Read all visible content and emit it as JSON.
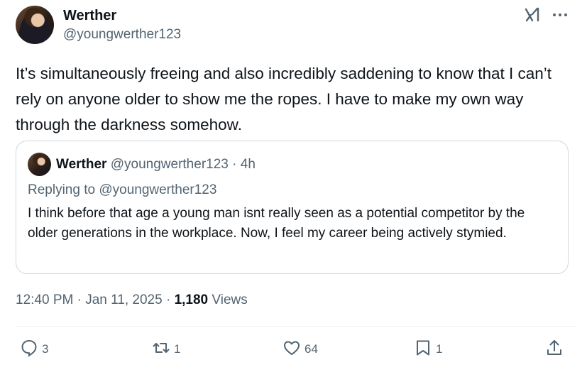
{
  "author": {
    "name": "Werther",
    "handle": "@youngwerther123"
  },
  "tweet": {
    "text": "It’s simultaneously freeing and also incredibly saddening to know that I can’t rely on anyone older to show me the ropes. I have to make my own way through the darkness somehow.",
    "time": "12:40 PM",
    "separator": "·",
    "date": "Jan 11, 2025",
    "views_count": "1,180",
    "views_label": "Views"
  },
  "quote": {
    "name": "Werther",
    "handle": "@youngwerther123",
    "separator": "·",
    "age": "4h",
    "replying_to": "Replying to @youngwerther123",
    "text": "I think before that age a young man isnt really seen as a potential competitor by the older generations in the workplace. Now, I feel my career being actively stymied."
  },
  "actions": {
    "reply_count": "3",
    "repost_count": "1",
    "like_count": "64",
    "bookmark_count": "1"
  },
  "icons": {
    "grok": "grok-icon",
    "more": "more-icon",
    "reply": "reply-icon",
    "repost": "repost-icon",
    "like": "heart-icon",
    "bookmark": "bookmark-icon",
    "share": "share-icon"
  },
  "colors": {
    "text_primary": "#0f1419",
    "text_secondary": "#536471",
    "border": "#cfd9de"
  }
}
